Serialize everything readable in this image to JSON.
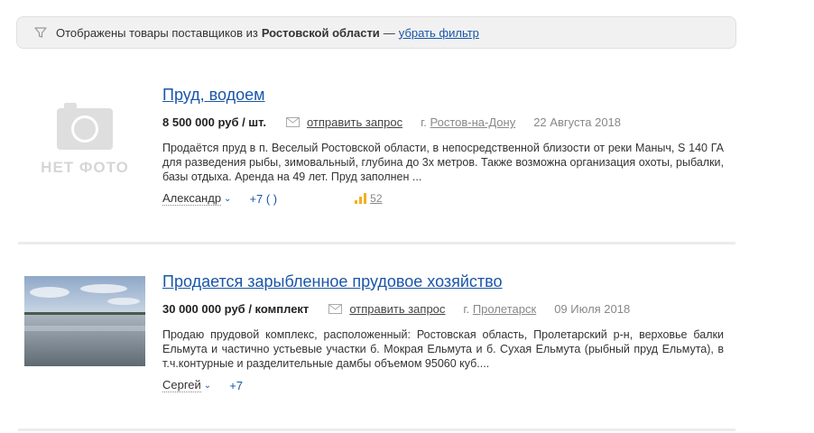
{
  "filter": {
    "prefix": "Отображены товары поставщиков из",
    "region": "Ростовской области",
    "dash": "—",
    "remove_label": "убрать фильтр"
  },
  "listings": [
    {
      "title": "Пруд, водоем",
      "photo_placeholder": "НЕТ ФОТО",
      "price": "8 500 000 руб / шт.",
      "request_label": "отправить запрос",
      "city_prefix": "г.",
      "city": "Ростов-на-Дону",
      "date": "22 Августа 2018",
      "description": "Продаётся пруд в п. Веселый Ростовской области, в непосредственной близости от реки Маныч, S 140 ГА для разведения рыбы, зимовальный, глубина до 3х метров. Также возможна организация охоты, рыбалки, базы отдыха. Аренда на 49 лет. Пруд заполнен ...",
      "seller": "Александр",
      "phone": "+7 (      )",
      "views": "52"
    },
    {
      "title": "Продается зарыбленное прудовое хозяйство",
      "price": "30 000 000 руб / комплект",
      "request_label": "отправить запрос",
      "city_prefix": "г.",
      "city": "Пролетарск",
      "date": "09 Июля 2018",
      "description": "Продаю прудовой комплекс, расположенный: Ростовская область, Пролетарский р-н, верховье балки Ельмута и частично устьевые участки б. Мокрая Ельмута и б. Сухая Ельмута (рыбный пруд Ельмута), в т.ч.контурные и разделительные дамбы объемом 95060 куб....",
      "seller": "Сергей",
      "phone": "+7"
    }
  ]
}
